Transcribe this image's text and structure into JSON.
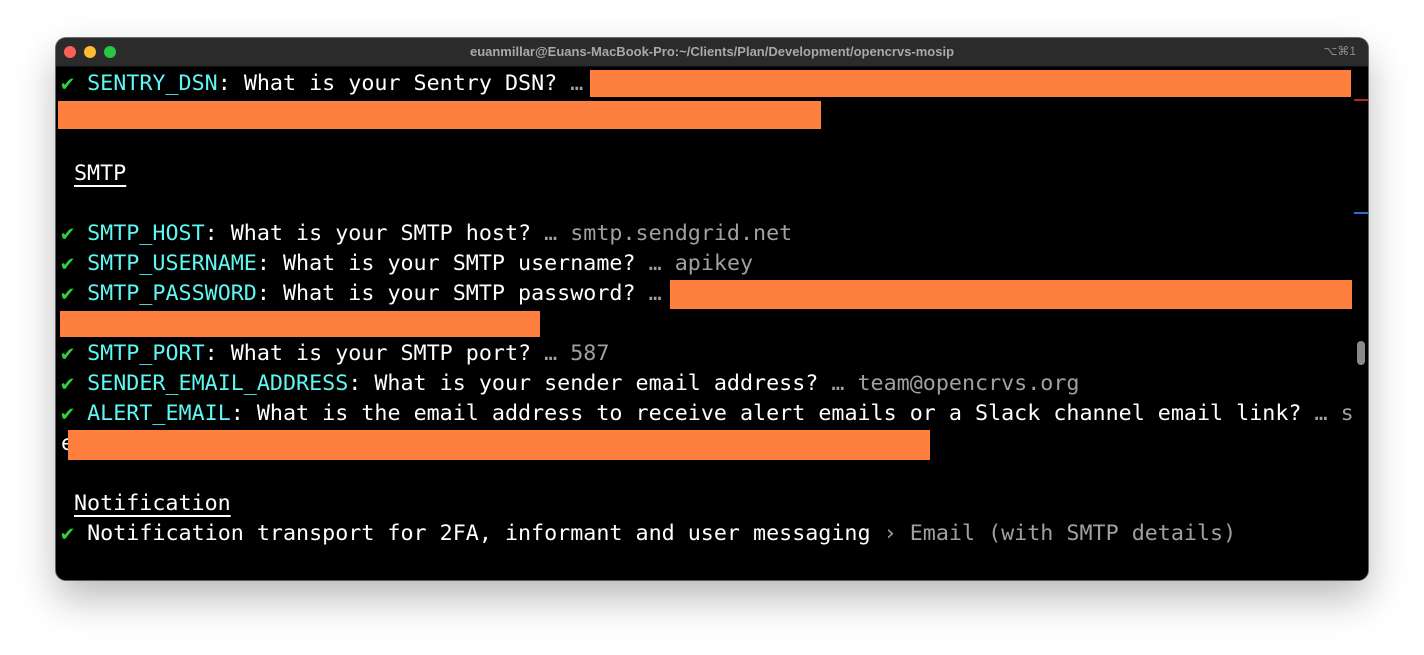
{
  "window": {
    "title": "euanmillar@Euans-MacBook-Pro:~/Clients/Plan/Development/opencrvs-mosip",
    "shortcut": "⌥⌘1"
  },
  "colors": {
    "check": "#2fd23a",
    "key": "#5ff7f2",
    "redaction": "#ff7f3f",
    "dim": "#a0a0a0"
  },
  "terminal": {
    "check_mark": "✔",
    "ellipsis": "…",
    "arrow": "›",
    "sentry": {
      "key": "SENTRY_DSN",
      "question": ": What is your Sentry DSN? "
    },
    "smtp_heading": "SMTP",
    "smtp_host": {
      "key": "SMTP_HOST",
      "question": ": What is your SMTP host? ",
      "value": " smtp.sendgrid.net"
    },
    "smtp_username": {
      "key": "SMTP_USERNAME",
      "question": ": What is your SMTP username? ",
      "value": " apikey"
    },
    "smtp_password": {
      "key": "SMTP_PASSWORD",
      "question": ": What is your SMTP password? "
    },
    "smtp_port": {
      "key": "SMTP_PORT",
      "question": ": What is your SMTP port? ",
      "value": " 587"
    },
    "sender_email": {
      "key": "SENDER_EMAIL_ADDRESS",
      "question": ": What is your sender email address? ",
      "value": " team@opencrvs.org"
    },
    "alert_email": {
      "key": "ALERT_EMAIL",
      "question": ": What is the email address to receive alert emails or a Slack channel email link? ",
      "value_start": " s",
      "value_wrap": "e"
    },
    "notification_heading": "Notification",
    "notification": {
      "question": " Notification transport for 2FA, informant and user messaging ",
      "value": " Email (with SMTP details)"
    }
  }
}
